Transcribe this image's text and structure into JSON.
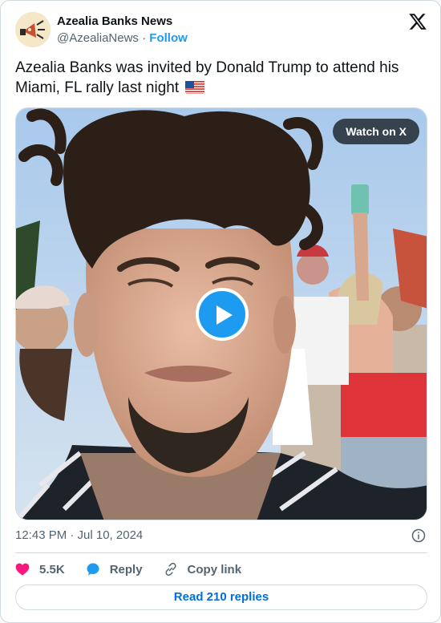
{
  "author": {
    "display_name": "Azealia Banks News",
    "handle": "@AzealiaNews",
    "separator": "·",
    "follow_label": "Follow"
  },
  "tweet": {
    "text": "Azealia Banks was invited by Donald Trump to attend his Miami, FL rally last night",
    "emoji_icon": "us-flag-icon"
  },
  "media": {
    "watch_label": "Watch on X",
    "play_icon": "play-icon"
  },
  "meta": {
    "timestamp": "12:43 PM · Jul 10, 2024",
    "info_icon": "info-icon"
  },
  "actions": {
    "likes": "5.5K",
    "reply_label": "Reply",
    "copy_label": "Copy link"
  },
  "footer": {
    "read_replies": "Read 210 replies"
  },
  "colors": {
    "accent": "#1d9bf0",
    "like": "#f91880",
    "text_secondary": "#536471",
    "border": "#cfd9de"
  }
}
